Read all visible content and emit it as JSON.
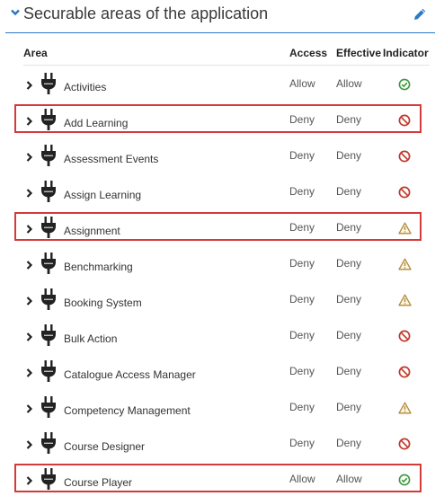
{
  "panel": {
    "title": "Securable areas of the application",
    "columns": {
      "area": "Area",
      "access": "Access",
      "effective": "Effective",
      "indicator": "Indicator"
    }
  },
  "rows": [
    {
      "name": "Activities",
      "access": "Allow",
      "effective": "Allow",
      "indicator": "allowed-check-icon",
      "highlighted": false
    },
    {
      "name": "Add Learning",
      "access": "Deny",
      "effective": "Deny",
      "indicator": "denied-icon",
      "highlighted": true
    },
    {
      "name": "Assessment Events",
      "access": "Deny",
      "effective": "Deny",
      "indicator": "denied-icon",
      "highlighted": false
    },
    {
      "name": "Assign Learning",
      "access": "Deny",
      "effective": "Deny",
      "indicator": "denied-icon",
      "highlighted": false
    },
    {
      "name": "Assignment",
      "access": "Deny",
      "effective": "Deny",
      "indicator": "warning-icon",
      "highlighted": true
    },
    {
      "name": "Benchmarking",
      "access": "Deny",
      "effective": "Deny",
      "indicator": "warning-icon",
      "highlighted": false
    },
    {
      "name": "Booking System",
      "access": "Deny",
      "effective": "Deny",
      "indicator": "warning-icon",
      "highlighted": false
    },
    {
      "name": "Bulk Action",
      "access": "Deny",
      "effective": "Deny",
      "indicator": "denied-icon",
      "highlighted": false
    },
    {
      "name": "Catalogue Access Manager",
      "access": "Deny",
      "effective": "Deny",
      "indicator": "denied-icon",
      "highlighted": false
    },
    {
      "name": "Competency Management",
      "access": "Deny",
      "effective": "Deny",
      "indicator": "warning-icon",
      "highlighted": false
    },
    {
      "name": "Course Designer",
      "access": "Deny",
      "effective": "Deny",
      "indicator": "denied-icon",
      "highlighted": false
    },
    {
      "name": "Course Player",
      "access": "Allow",
      "effective": "Allow",
      "indicator": "allowed-check-icon",
      "highlighted": true
    }
  ],
  "colors": {
    "accent": "#2b78c5",
    "allowed": "#3a9a3a",
    "denied": "#c0392b",
    "warning": "#b08a3a",
    "highlight_border": "#d33a3a"
  }
}
